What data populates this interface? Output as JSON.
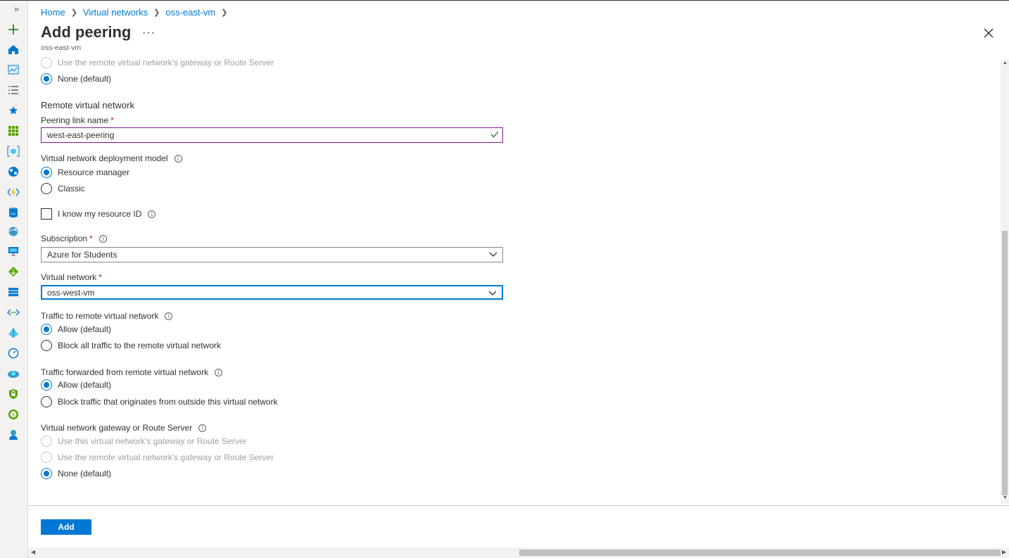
{
  "breadcrumb": {
    "items": [
      "Home",
      "Virtual networks",
      "oss-east-vm"
    ]
  },
  "header": {
    "title": "Add peering",
    "subtitle": "oss-east-vm",
    "more_label": "···"
  },
  "top_gateway": {
    "options": [
      {
        "label": "Use the remote virtual network's gateway or Route Server",
        "checked": false,
        "disabled": true
      },
      {
        "label": "None (default)",
        "checked": true,
        "disabled": false
      }
    ]
  },
  "remote": {
    "section_title": "Remote virtual network",
    "peering_link_label": "Peering link name",
    "peering_link_value": "west-east-peering",
    "deployment_label": "Virtual network deployment model",
    "deployment_options": [
      {
        "label": "Resource manager",
        "checked": true
      },
      {
        "label": "Classic",
        "checked": false
      }
    ],
    "resource_id_label": "I know my resource ID",
    "resource_id_checked": false,
    "subscription_label": "Subscription",
    "subscription_value": "Azure for Students",
    "vnet_label": "Virtual network",
    "vnet_value": "oss-west-vm",
    "traffic_remote_label": "Traffic to remote virtual network",
    "traffic_remote_options": [
      {
        "label": "Allow (default)",
        "checked": true
      },
      {
        "label": "Block all traffic to the remote virtual network",
        "checked": false
      }
    ],
    "traffic_forwarded_label": "Traffic forwarded from remote virtual network",
    "traffic_forwarded_options": [
      {
        "label": "Allow (default)",
        "checked": true
      },
      {
        "label": "Block traffic that originates from outside this virtual network",
        "checked": false
      }
    ],
    "gateway_label": "Virtual network gateway or Route Server",
    "gateway_options": [
      {
        "label": "Use this virtual network's gateway or Route Server",
        "checked": false,
        "disabled": true
      },
      {
        "label": "Use the remote virtual network's gateway or Route Server",
        "checked": false,
        "disabled": true
      },
      {
        "label": "None (default)",
        "checked": true,
        "disabled": false
      }
    ]
  },
  "footer": {
    "add_label": "Add"
  },
  "colors": {
    "accent": "#0078d4",
    "required": "#a4262c",
    "valid_border": "#881798",
    "valid_check": "#107c10"
  },
  "rail_icons": [
    "plus-icon",
    "home-icon",
    "dashboard-icon",
    "all-services-icon",
    "favorites-star-icon",
    "all-resources-icon",
    "resource-groups-icon",
    "app-services-icon",
    "function-app-icon",
    "sql-database-icon",
    "cosmos-db-icon",
    "virtual-machine-icon",
    "load-balancer-icon",
    "storage-account-icon",
    "virtual-network-icon",
    "azure-ad-icon",
    "monitor-icon",
    "advisor-icon",
    "security-center-icon",
    "cost-management-icon",
    "help-support-icon"
  ]
}
